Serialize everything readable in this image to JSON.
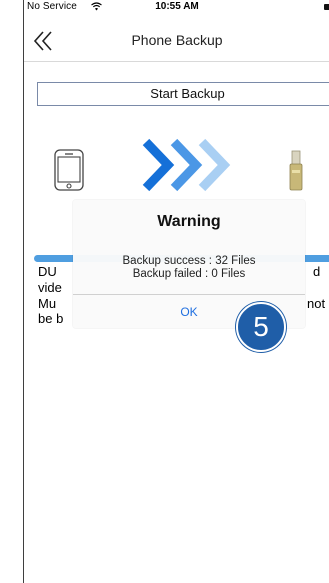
{
  "status_bar": {
    "carrier": "No Service",
    "time": "10:55 AM"
  },
  "nav": {
    "title": "Phone Backup",
    "back_icon": "double-chevron-left-icon"
  },
  "main": {
    "start_backup_label": "Start Backup",
    "icons": [
      "phone-icon",
      "arrows-icon",
      "usb-drive-icon"
    ],
    "progress": 1.0,
    "body_lines": [
      {
        "left": "DU",
        "right": "d"
      },
      {
        "left": "vide",
        "right": ""
      },
      {
        "left": "Mu",
        "right": "not"
      },
      {
        "left": "be b",
        "right": ""
      }
    ]
  },
  "dialog": {
    "title": "Warning",
    "success_line": "Backup success : 32 Files",
    "failed_line": "Backup failed : 0 Files",
    "ok_label": "OK"
  },
  "annotation": {
    "step_number": "5"
  },
  "colors": {
    "accent_blue": "#1f6fe0",
    "progress_blue": "#4f9ee0",
    "badge_blue": "#1f5ea8"
  }
}
